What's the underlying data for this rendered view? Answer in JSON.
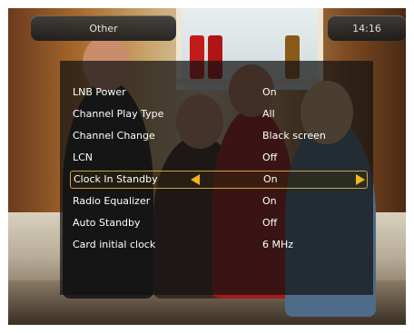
{
  "header": {
    "title": "Other",
    "time": "14:16"
  },
  "menu": {
    "items": [
      {
        "label": "LNB Power",
        "value": "On"
      },
      {
        "label": "Channel Play Type",
        "value": "All"
      },
      {
        "label": "Channel Change",
        "value": "Black screen"
      },
      {
        "label": "LCN",
        "value": "Off"
      },
      {
        "label": "Clock In Standby",
        "value": "On"
      },
      {
        "label": "Radio Equalizer",
        "value": "On"
      },
      {
        "label": "Auto Standby",
        "value": "Off"
      },
      {
        "label": "Card initial clock",
        "value": "6 MHz"
      }
    ],
    "selected_index": 4,
    "selected_arrow_color": "#f5b31b",
    "selection_border_color": "#c9a24a"
  }
}
